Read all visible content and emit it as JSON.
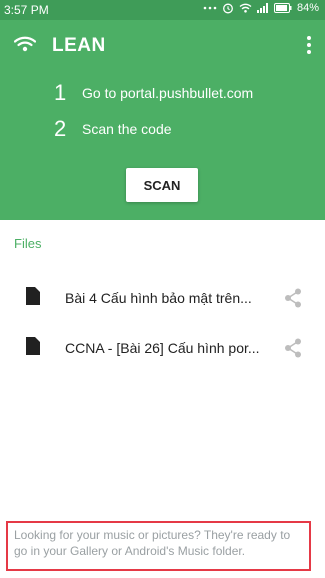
{
  "status_bar": {
    "time": "3:57 PM",
    "battery": "84%"
  },
  "header": {
    "title": "LEAN",
    "steps": [
      {
        "number": "1",
        "text": "Go to portal.pushbullet.com"
      },
      {
        "number": "2",
        "text": "Scan the code"
      }
    ],
    "scan_label": "SCAN"
  },
  "files": {
    "section_label": "Files",
    "items": [
      {
        "name": "Bài 4 Cấu hình bảo mật trên..."
      },
      {
        "name": "CCNA - [Bài 26] Cấu hình por..."
      }
    ]
  },
  "footer_note": "Looking for your music or pictures? They're ready to go in your Gallery or Android's Music folder.",
  "colors": {
    "accent": "#4caf65",
    "status_bar": "#3f9c58",
    "highlight_border": "#e53946"
  }
}
